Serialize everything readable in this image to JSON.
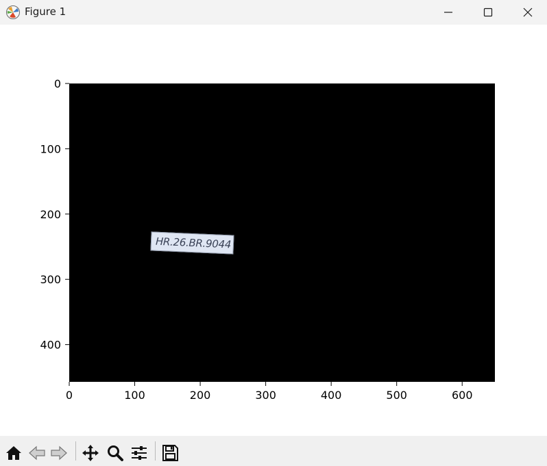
{
  "window": {
    "title": "Figure 1",
    "app_icon": "matplotlib-icon",
    "controls": [
      "minimize-icon",
      "maximize-icon",
      "close-icon"
    ]
  },
  "plot": {
    "x_tick_labels": [
      "0",
      "100",
      "200",
      "300",
      "400",
      "500",
      "600"
    ],
    "y_tick_labels": [
      "0",
      "100",
      "200",
      "300",
      "400"
    ],
    "x_range": [
      0,
      650
    ],
    "y_range": [
      457,
      0
    ],
    "background_color": "#000000",
    "plate_text": "HR.26.BR.9044",
    "plate_color": "#dfe6f3"
  },
  "toolbar": {
    "tools": [
      "home-icon",
      "back-arrow-icon",
      "forward-arrow-icon",
      "pan-icon",
      "zoom-icon",
      "configure-subplots-icon",
      "save-icon"
    ]
  }
}
